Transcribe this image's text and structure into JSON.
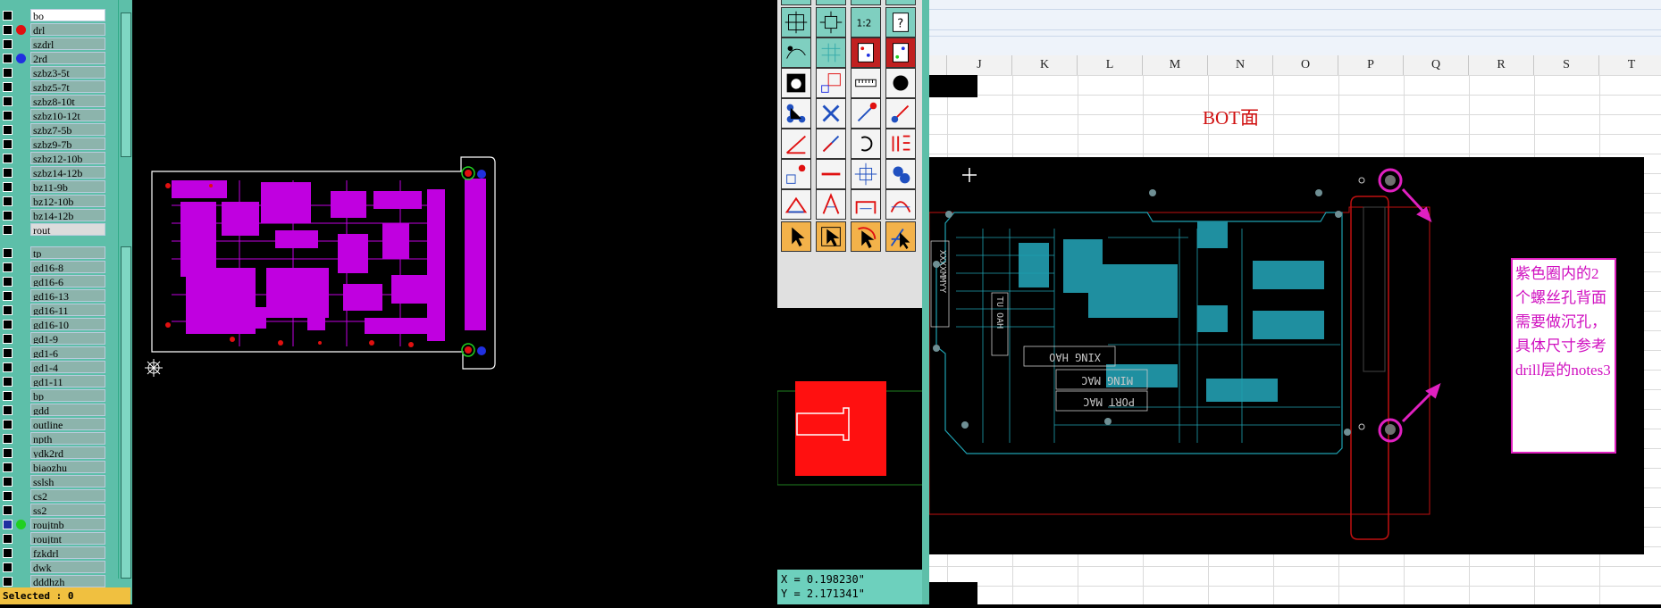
{
  "layers_top": [
    {
      "name": "bo",
      "dot": "",
      "style": "white"
    },
    {
      "name": "drl",
      "dot": "#e01010",
      "style": ""
    },
    {
      "name": "szdrl",
      "dot": "",
      "style": ""
    },
    {
      "name": "2rd",
      "dot": "#2030e0",
      "style": ""
    },
    {
      "name": "szbz3-5t",
      "dot": "",
      "style": ""
    },
    {
      "name": "szbz5-7t",
      "dot": "",
      "style": ""
    },
    {
      "name": "szbz8-10t",
      "dot": "",
      "style": ""
    },
    {
      "name": "szbz10-12t",
      "dot": "",
      "style": ""
    },
    {
      "name": "szbz7-5b",
      "dot": "",
      "style": ""
    },
    {
      "name": "szbz9-7b",
      "dot": "",
      "style": ""
    },
    {
      "name": "szbz12-10b",
      "dot": "",
      "style": ""
    },
    {
      "name": "szbz14-12b",
      "dot": "",
      "style": ""
    },
    {
      "name": "bz11-9b",
      "dot": "",
      "style": ""
    },
    {
      "name": "bz12-10b",
      "dot": "",
      "style": ""
    },
    {
      "name": "bz14-12b",
      "dot": "",
      "style": ""
    },
    {
      "name": "rout",
      "dot": "",
      "style": "light"
    }
  ],
  "layers_bottom": [
    {
      "name": "tp",
      "dot": "",
      "style": ""
    },
    {
      "name": "gd16-8",
      "dot": "",
      "style": ""
    },
    {
      "name": "gd16-6",
      "dot": "",
      "style": ""
    },
    {
      "name": "gd16-13",
      "dot": "",
      "style": ""
    },
    {
      "name": "gd16-11",
      "dot": "",
      "style": ""
    },
    {
      "name": "gd16-10",
      "dot": "",
      "style": ""
    },
    {
      "name": "gd1-9",
      "dot": "",
      "style": ""
    },
    {
      "name": "gd1-6",
      "dot": "",
      "style": ""
    },
    {
      "name": "gd1-4",
      "dot": "",
      "style": ""
    },
    {
      "name": "gd1-11",
      "dot": "",
      "style": ""
    },
    {
      "name": "bp",
      "dot": "",
      "style": ""
    },
    {
      "name": "gdd",
      "dot": "",
      "style": ""
    },
    {
      "name": "outline",
      "dot": "",
      "style": ""
    },
    {
      "name": "npth",
      "dot": "",
      "style": ""
    },
    {
      "name": "ydk2rd",
      "dot": "",
      "style": ""
    },
    {
      "name": "biaozhu",
      "dot": "",
      "style": ""
    },
    {
      "name": "sslsh",
      "dot": "",
      "style": ""
    },
    {
      "name": "cs2",
      "dot": "",
      "style": ""
    },
    {
      "name": "ss2",
      "dot": "",
      "style": ""
    },
    {
      "name": "roujtnb",
      "dot": "#20d020",
      "style": "",
      "marker": true
    },
    {
      "name": "roujtnt",
      "dot": "",
      "style": ""
    },
    {
      "name": "fzkdrl",
      "dot": "",
      "style": ""
    },
    {
      "name": "dwk",
      "dot": "",
      "style": ""
    },
    {
      "name": "dddhzh",
      "dot": "",
      "style": ""
    }
  ],
  "status": {
    "selected": "Selected : 0"
  },
  "coords": {
    "x": "X = 0.198230\"",
    "y": "Y = 2.171341\""
  },
  "toolbox": {
    "zoom_label": "1:2",
    "help_label": "?",
    "tools": [
      "zoom-fit-icon",
      "zoom-center-icon",
      "zoom-ratio-icon",
      "help-icon",
      "measure-icon",
      "grid-icon",
      "layer-toggle-icon",
      "layer-toggle-2-icon",
      "snapshot-icon",
      "select-box-icon",
      "ruler-icon",
      "pad-icon",
      "connect-nodes-icon",
      "cross-node-icon",
      "line-node-icon",
      "diagonal-node-icon",
      "angle-line-icon",
      "slash-line-icon",
      "rotate-icon",
      "split-icon",
      "move-node-icon",
      "horizontal-line-icon",
      "snap-center-icon",
      "multi-pad-icon",
      "triangle-icon",
      "arrow-triangle-icon",
      "bridge-icon",
      "arch-icon",
      "pointer-icon",
      "pointer-select-icon",
      "pointer-rotate-icon",
      "pointer-branch-icon"
    ]
  },
  "sheet": {
    "columns": [
      "J",
      "K",
      "L",
      "M",
      "N",
      "O",
      "P",
      "Q",
      "R",
      "S",
      "T"
    ],
    "title": "BOT面",
    "note": "紫色圈内的2个螺丝孔背面需要做沉孔，具体尺寸参考drill层的notes3",
    "board_text": [
      "XING HAO",
      "MING MAC",
      "PORT MAC",
      "XXXXMMYY",
      "TU OAH"
    ]
  },
  "colors": {
    "panel": "#5dbfa9",
    "trace": "#c000e0",
    "pcb_trace": "#1fa0b0",
    "annotation": "#e020c0",
    "title": "#d01010"
  }
}
